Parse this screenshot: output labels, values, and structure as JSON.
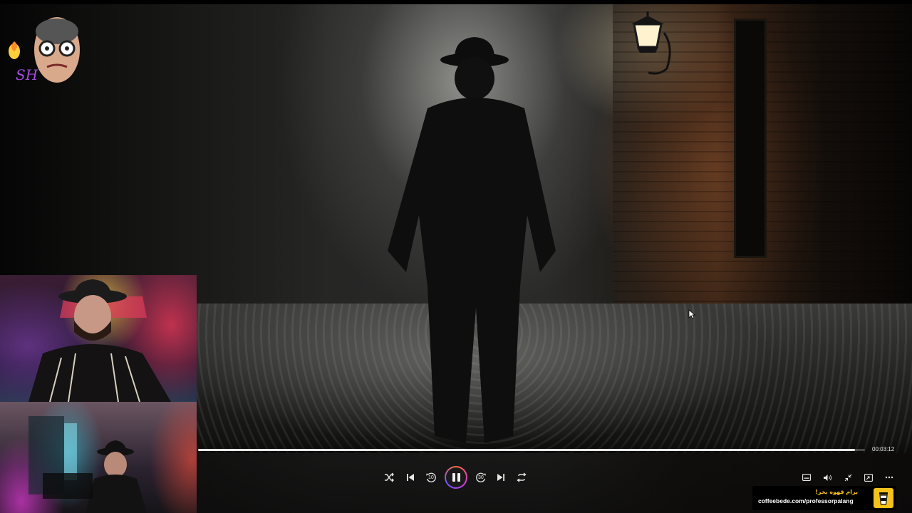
{
  "player": {
    "timestamp": "00:03:12",
    "progress_fraction": 0.985,
    "state": "playing",
    "controls": {
      "shuffle": {
        "icon": "shuffle-icon"
      },
      "previous": {
        "icon": "previous-track-icon"
      },
      "rewind": {
        "icon": "rewind-10-icon",
        "label": "10"
      },
      "pause": {
        "icon": "pause-icon"
      },
      "forward": {
        "icon": "forward-30-icon",
        "label": "30"
      },
      "next": {
        "icon": "next-track-icon"
      },
      "repeat": {
        "icon": "repeat-icon"
      }
    },
    "right_controls": [
      {
        "icon": "captions-icon"
      },
      {
        "icon": "volume-icon"
      },
      {
        "icon": "exit-fullscreen-icon"
      },
      {
        "icon": "miniplayer-icon"
      },
      {
        "icon": "more-options-icon"
      }
    ]
  },
  "overlay": {
    "channel_logo_text": "SH",
    "donation": {
      "line1": "برام قهوه بخر!",
      "line2": "coffeebede.com/professorpalang",
      "icon": "coffee-cup-icon"
    }
  },
  "colors": {
    "accent_gradient": [
      "#ff6a3d",
      "#d43bd0",
      "#6a58ff"
    ],
    "donate_yellow": "#f4c21a"
  }
}
